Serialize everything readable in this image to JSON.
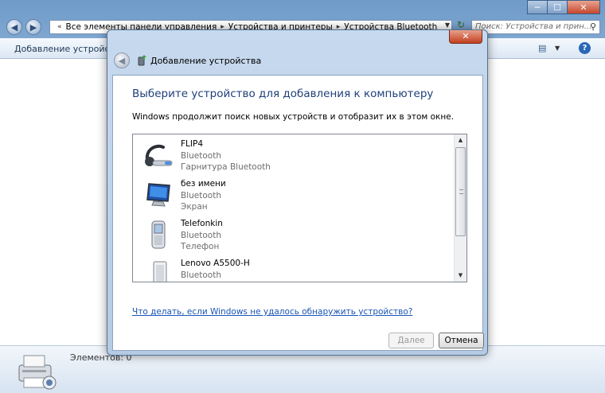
{
  "explorer": {
    "nav": {
      "back": "◀",
      "forward": "▶"
    },
    "breadcrumb": [
      "Все элементы панели управления",
      "Устройства и принтеры",
      "Устройства Bluetooth"
    ],
    "breadcrumb_sep": "▸",
    "search_placeholder": "Поиск: Устройства и прин...",
    "toolbar": {
      "add_device": "Добавление устройства"
    },
    "status": {
      "items_count": "Элементов: 0"
    },
    "window_controls": {
      "minimize": "─",
      "maximize": "☐",
      "close": "✕"
    }
  },
  "dialog": {
    "title": "Добавление устройства",
    "close_label": "✕",
    "heading": "Выберите устройство для добавления к компьютеру",
    "subtext": "Windows продолжит поиск новых устройств и отобразит их в этом окне.",
    "devices": [
      {
        "name": "FLIP4",
        "type": "Bluetooth",
        "category": "Гарнитура Bluetooth",
        "icon": "headset-icon"
      },
      {
        "name": "без имени",
        "type": "Bluetooth",
        "category": "Экран",
        "icon": "monitor-icon"
      },
      {
        "name": "Telefonkin",
        "type": "Bluetooth",
        "category": "Телефон",
        "icon": "phone-icon"
      },
      {
        "name": "Lenovo A5500-H",
        "type": "Bluetooth",
        "category": "",
        "icon": "tablet-icon"
      }
    ],
    "help_link": "Что делать, если Windows не удалось обнаружить устройство?",
    "buttons": {
      "next": "Далее",
      "cancel": "Отмена"
    }
  },
  "colors": {
    "heading": "#1f3f7a",
    "link": "#1a55b5",
    "close_button": "#c2401f"
  }
}
